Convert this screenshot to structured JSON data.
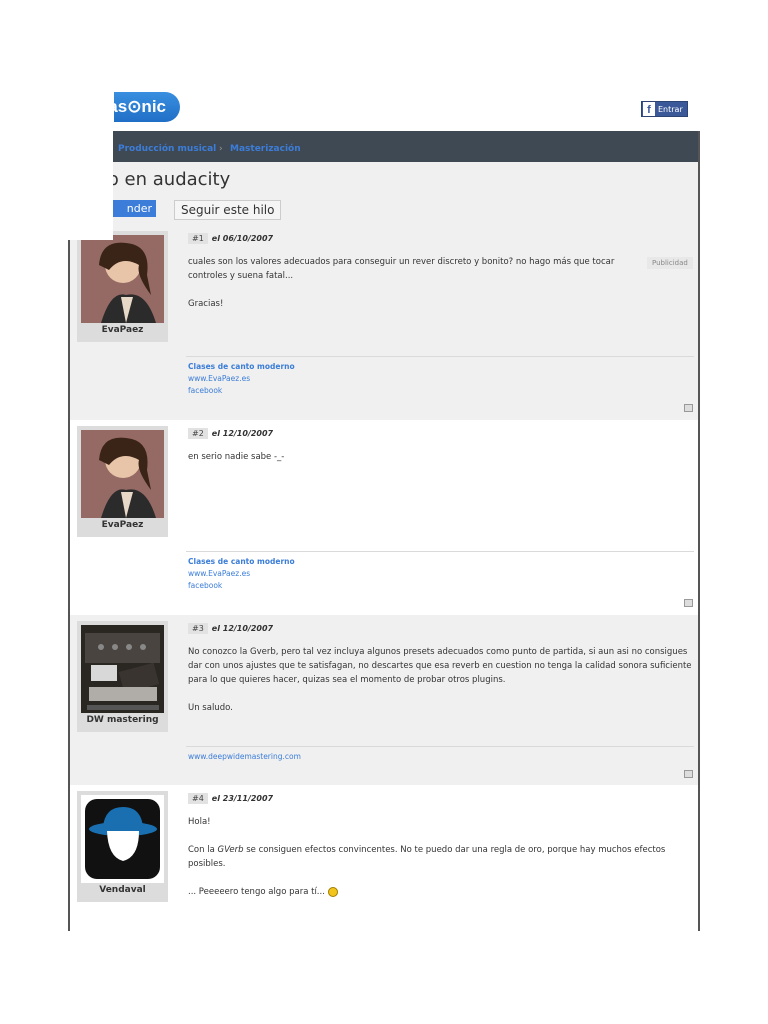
{
  "header": {
    "logo_text": "as⊙nic",
    "login_label": "Entrar",
    "fb_glyph": "f"
  },
  "breadcrumb": {
    "items": [
      "Producción musical",
      "Masterización"
    ],
    "separator": "›"
  },
  "thread": {
    "title": "rb en audacity",
    "reply_label": "nder",
    "follow_label": "Seguir este hilo",
    "ad_label": "Publicidad"
  },
  "posts": [
    {
      "num": "#1",
      "date": "el 06/10/2007",
      "user": "EvaPaez",
      "lines": [
        "cuales son los valores adecuados para conseguir un rever discreto y bonito? no hago más que tocar",
        "controles y suena fatal...",
        "",
        "Gracias!"
      ],
      "sig": [
        "Clases de canto moderno",
        "www.EvaPaez.es",
        "facebook"
      ]
    },
    {
      "num": "#2",
      "date": "el 12/10/2007",
      "user": "EvaPaez",
      "lines": [
        "en serio nadie sabe -_-"
      ],
      "sig": [
        "Clases de canto moderno",
        "www.EvaPaez.es",
        "facebook"
      ]
    },
    {
      "num": "#3",
      "date": "el 12/10/2007",
      "user": "DW mastering",
      "lines": [
        "No conozco la Gverb, pero tal vez incluya algunos presets adecuados como punto de partida, si aun asi no consigues",
        "dar con unos ajustes que te satisfagan, no descartes que esa reverb en cuestion no tenga la calidad sonora suficiente",
        "para lo que quieres hacer, quizas sea el momento de probar otros plugins.",
        "",
        "Un saludo."
      ],
      "sig": [
        "www.deepwidemastering.com"
      ]
    },
    {
      "num": "#4",
      "date": "el 23/11/2007",
      "user": "Vendaval",
      "lines_a": "Hola!",
      "line_b_pre": "Con la ",
      "line_b_em": "GVerb",
      "line_b_post": " se consiguen efectos convincentes. No te puedo dar una regla de oro, porque hay muchos efectos",
      "line_c": "posibles.",
      "line_d": "... Peeeeero tengo algo para tí..."
    }
  ]
}
